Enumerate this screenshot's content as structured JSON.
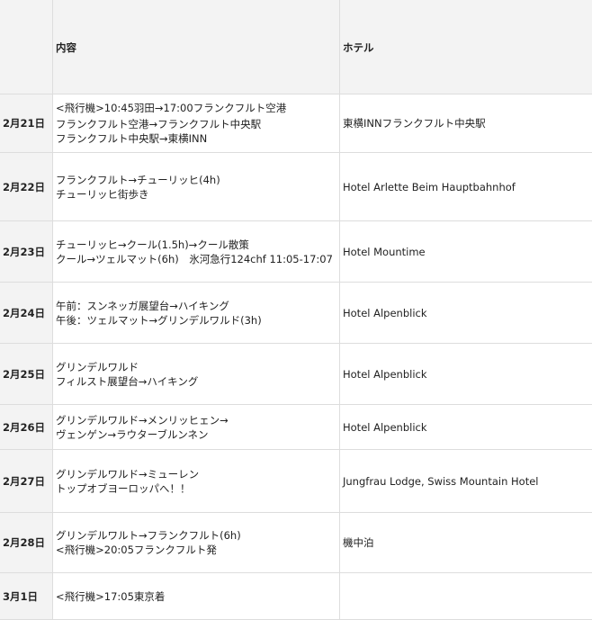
{
  "header": {
    "date": "",
    "content": "内容",
    "hotel": "ホテル"
  },
  "rows": [
    {
      "date": "2月21日",
      "content": [
        "<飛行機>10:45羽田→17:00フランクフルト空港",
        "フランクフルト空港→フランクフルト中央駅",
        "フランクフルト中央駅→東横INN"
      ],
      "hotel": "東横INNフランクフルト中央駅"
    },
    {
      "date": "2月22日",
      "content": [
        "フランクフルト→チューリッヒ(4h)",
        "チューリッヒ街歩き"
      ],
      "hotel": "Hotel Arlette Beim Hauptbahnhof"
    },
    {
      "date": "2月23日",
      "content": [
        "チューリッヒ→クール(1.5h)→クール散策",
        "クール→ツェルマット(6h)　氷河急行124chf 11:05-17:07"
      ],
      "hotel": "Hotel Mountime"
    },
    {
      "date": "2月24日",
      "content": [
        "午前：スンネッガ展望台→ハイキング",
        "午後：ツェルマット→グリンデルワルド(3h)"
      ],
      "hotel": "Hotel Alpenblick"
    },
    {
      "date": "2月25日",
      "content": [
        "グリンデルワルド",
        "フィルスト展望台→ハイキング"
      ],
      "hotel": "Hotel Alpenblick"
    },
    {
      "date": "2月26日",
      "content": [
        "グリンデルワルド→メンリッヒェン→",
        "ヴェンゲン→ラウターブルンネン"
      ],
      "hotel": "Hotel Alpenblick"
    },
    {
      "date": "2月27日",
      "content": [
        "グリンデルワルド→ミューレン",
        "トップオブヨーロッパへ！！"
      ],
      "hotel": "Jungfrau Lodge, Swiss Mountain Hotel"
    },
    {
      "date": "2月28日",
      "content": [
        "グリンデルワルト→フランクフルト(6h)",
        "<飛行機>20:05フランクフルト発"
      ],
      "hotel": "機中泊"
    },
    {
      "date": "3月1日",
      "content": [
        "<飛行機>17:05東京着"
      ],
      "hotel": ""
    }
  ]
}
